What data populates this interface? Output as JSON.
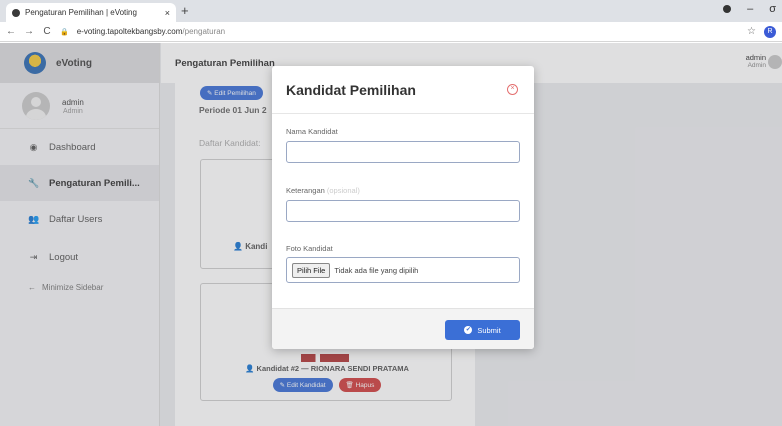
{
  "browser": {
    "tab_title": "Pengaturan Pemilihan | eVoting",
    "tab_close": "×",
    "new_tab": "+",
    "url_host": "e-voting.tapoltekbangsby.com",
    "url_path": "/pengaturan",
    "profile_initial": "R",
    "back": "←",
    "forward": "→",
    "reload": "C",
    "minimize": "–",
    "restore": "σ",
    "star": "☆"
  },
  "sidebar": {
    "brand": "eVoting",
    "user_name": "admin",
    "user_role": "Admin",
    "items": [
      {
        "label": "Dashboard",
        "icon": "dashboard-icon",
        "glyph": "◉"
      },
      {
        "label": "Pengaturan Pemili...",
        "icon": "wrench-icon",
        "glyph": "🔧"
      },
      {
        "label": "Daftar Users",
        "icon": "users-icon",
        "glyph": "👥"
      },
      {
        "label": "Logout",
        "icon": "logout-icon",
        "glyph": "⇥"
      }
    ],
    "minimize_label": "Minimize Sidebar",
    "minimize_glyph": "←"
  },
  "header": {
    "page_title": "Pengaturan Pemilihan",
    "user_name": "admin",
    "user_role": "Admin"
  },
  "main": {
    "edit_pemilihan": "Edit Pemilihan",
    "periode": "Periode 01 Jun 2",
    "daftar_kandidat": "Daftar Kandidat:",
    "candidate1_label": "Kandi",
    "candidate2_label": "Kandidat #2 — RIONARA SENDI PRATAMA",
    "edit_kandidat": "Edit Kandidat",
    "hapus": "Hapus"
  },
  "modal": {
    "title": "Kandidat Pemilihan",
    "close": "×",
    "nama_label": "Nama Kandidat",
    "nama_value": "",
    "keterangan_label": "Keterangan",
    "keterangan_optional": "(opsional)",
    "keterangan_value": "",
    "foto_label": "Foto Kandidat",
    "file_button": "Pilih File",
    "file_status": "Tidak ada file yang dipilih",
    "submit": "Submit"
  },
  "colors": {
    "accent": "#3b6fd6",
    "danger": "#d04040"
  }
}
